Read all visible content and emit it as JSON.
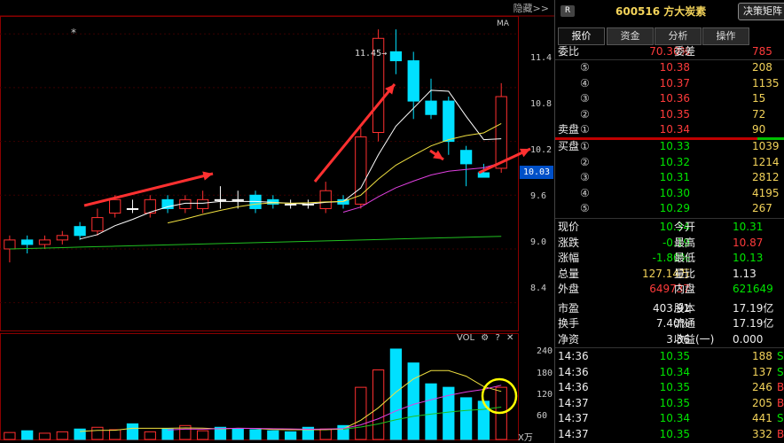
{
  "topbar": {
    "hide_label": "隐藏>>"
  },
  "chart": {
    "star": "*",
    "ma_label": "MA",
    "peak_label": "11.45→",
    "current_price": "10.03",
    "price_ticks": [
      "11.4",
      "10.8",
      "10.2",
      "9.6",
      "9.0",
      "8.4"
    ],
    "vol_header": "VOL",
    "vol_ticks": [
      "240",
      "180",
      "120",
      "60"
    ],
    "vol_unit": "X万"
  },
  "chart_data": {
    "type": "candlestick",
    "price_ylim": [
      8.1,
      11.6
    ],
    "candles": [
      {
        "o": 9.0,
        "c": 9.1,
        "h": 9.15,
        "l": 8.85
      },
      {
        "o": 9.1,
        "c": 9.05,
        "h": 9.15,
        "l": 8.95
      },
      {
        "o": 9.05,
        "c": 9.1,
        "h": 9.15,
        "l": 9.0
      },
      {
        "o": 9.1,
        "c": 9.15,
        "h": 9.2,
        "l": 9.05
      },
      {
        "o": 9.25,
        "c": 9.15,
        "h": 9.3,
        "l": 9.1
      },
      {
        "o": 9.2,
        "c": 9.35,
        "h": 9.45,
        "l": 9.15
      },
      {
        "o": 9.4,
        "c": 9.55,
        "h": 9.6,
        "l": 9.35
      },
      {
        "o": 9.45,
        "c": 9.45,
        "h": 9.55,
        "l": 9.4
      },
      {
        "o": 9.4,
        "c": 9.55,
        "h": 9.6,
        "l": 9.35
      },
      {
        "o": 9.55,
        "c": 9.45,
        "h": 9.6,
        "l": 9.4
      },
      {
        "o": 9.45,
        "c": 9.55,
        "h": 9.6,
        "l": 9.4
      },
      {
        "o": 9.45,
        "c": 9.55,
        "h": 9.65,
        "l": 9.4
      },
      {
        "o": 9.55,
        "c": 9.55,
        "h": 9.7,
        "l": 9.45
      },
      {
        "o": 9.55,
        "c": 9.55,
        "h": 9.65,
        "l": 9.45
      },
      {
        "o": 9.6,
        "c": 9.45,
        "h": 9.65,
        "l": 9.4
      },
      {
        "o": 9.55,
        "c": 9.5,
        "h": 9.6,
        "l": 9.45
      },
      {
        "o": 9.5,
        "c": 9.5,
        "h": 9.55,
        "l": 9.45
      },
      {
        "o": 9.5,
        "c": 9.5,
        "h": 9.55,
        "l": 9.45
      },
      {
        "o": 9.45,
        "c": 9.65,
        "h": 9.75,
        "l": 9.4
      },
      {
        "o": 9.55,
        "c": 9.5,
        "h": 9.6,
        "l": 9.45
      },
      {
        "o": 9.5,
        "c": 10.25,
        "h": 10.35,
        "l": 9.45
      },
      {
        "o": 10.3,
        "c": 11.35,
        "h": 11.45,
        "l": 10.2
      },
      {
        "o": 11.2,
        "c": 11.1,
        "h": 11.45,
        "l": 10.95
      },
      {
        "o": 11.1,
        "c": 10.65,
        "h": 11.2,
        "l": 10.45
      },
      {
        "o": 10.65,
        "c": 10.5,
        "h": 10.9,
        "l": 10.45
      },
      {
        "o": 10.65,
        "c": 10.2,
        "h": 10.7,
        "l": 10.05
      },
      {
        "o": 10.1,
        "c": 9.95,
        "h": 10.15,
        "l": 9.7
      },
      {
        "o": 9.85,
        "c": 9.8,
        "h": 9.95,
        "l": 9.8
      },
      {
        "o": 9.9,
        "c": 10.7,
        "h": 10.85,
        "l": 9.85
      }
    ],
    "volumes": [
      20,
      25,
      18,
      22,
      30,
      35,
      28,
      45,
      22,
      30,
      40,
      25,
      35,
      30,
      28,
      25,
      22,
      35,
      30,
      40,
      150,
      200,
      260,
      220,
      160,
      150,
      120,
      110,
      150
    ],
    "vol_ylim": [
      0,
      265
    ]
  },
  "quote": {
    "badge": "R",
    "code_name": "600516 方大炭素",
    "decision_label": "决策矩阵",
    "tabs": [
      "报价",
      "资金",
      "分析",
      "操作"
    ],
    "weibi_label": "委比",
    "weibi_value": "70.30%",
    "weicha_label": "委差",
    "weicha_value": "785",
    "sell_label": "卖盘",
    "buy_label": "买盘",
    "sell": [
      {
        "n": "⑤",
        "price": "10.38",
        "vol": "208"
      },
      {
        "n": "④",
        "price": "10.37",
        "vol": "1135"
      },
      {
        "n": "③",
        "price": "10.36",
        "vol": "15"
      },
      {
        "n": "②",
        "price": "10.35",
        "vol": "72"
      },
      {
        "n": "①",
        "price": "10.34",
        "vol": "90"
      }
    ],
    "buy": [
      {
        "n": "①",
        "price": "10.33",
        "vol": "1039"
      },
      {
        "n": "②",
        "price": "10.32",
        "vol": "1214"
      },
      {
        "n": "③",
        "price": "10.31",
        "vol": "2812"
      },
      {
        "n": "④",
        "price": "10.30",
        "vol": "4195"
      },
      {
        "n": "⑤",
        "price": "10.29",
        "vol": "267"
      }
    ],
    "stats": [
      {
        "l1": "现价",
        "v1": "10.34",
        "l2": "今开",
        "v2": "10.31",
        "c1": "green",
        "c2": "green"
      },
      {
        "l1": "涨跌",
        "v1": "-0.19",
        "l2": "最高",
        "v2": "10.87",
        "c1": "green",
        "c2": "red"
      },
      {
        "l1": "涨幅",
        "v1": "-1.80%",
        "l2": "最低",
        "v2": "10.13",
        "c1": "green",
        "c2": "green"
      },
      {
        "l1": "总量",
        "v1": "127.14万",
        "l2": "量比",
        "v2": "1.13",
        "c1": "yellow",
        "c2": "white"
      },
      {
        "l1": "外盘",
        "v1": "649737",
        "l2": "内盘",
        "v2": "621649",
        "c1": "red",
        "c2": "green"
      },
      {
        "l1": "市盈",
        "v1": "403.91",
        "l2": "股本",
        "v2": "17.19亿",
        "c1": "white",
        "c2": "white"
      },
      {
        "l1": "换手",
        "v1": "7.40%",
        "l2": "流通",
        "v2": "17.19亿",
        "c1": "white",
        "c2": "white"
      },
      {
        "l1": "净资",
        "v1": "3.36",
        "l2": "收益(一)",
        "v2": "0.000",
        "c1": "white",
        "c2": "white"
      }
    ],
    "ticks": [
      {
        "time": "14:36",
        "price": "10.35",
        "vol": "188",
        "dir": "S"
      },
      {
        "time": "14:36",
        "price": "10.34",
        "vol": "137",
        "dir": "S"
      },
      {
        "time": "14:36",
        "price": "10.35",
        "vol": "246",
        "dir": "B"
      },
      {
        "time": "14:37",
        "price": "10.35",
        "vol": "205",
        "dir": "B"
      },
      {
        "time": "14:37",
        "price": "10.34",
        "vol": "441",
        "dir": "S"
      },
      {
        "time": "14:37",
        "price": "10.35",
        "vol": "332",
        "dir": "B"
      }
    ]
  }
}
